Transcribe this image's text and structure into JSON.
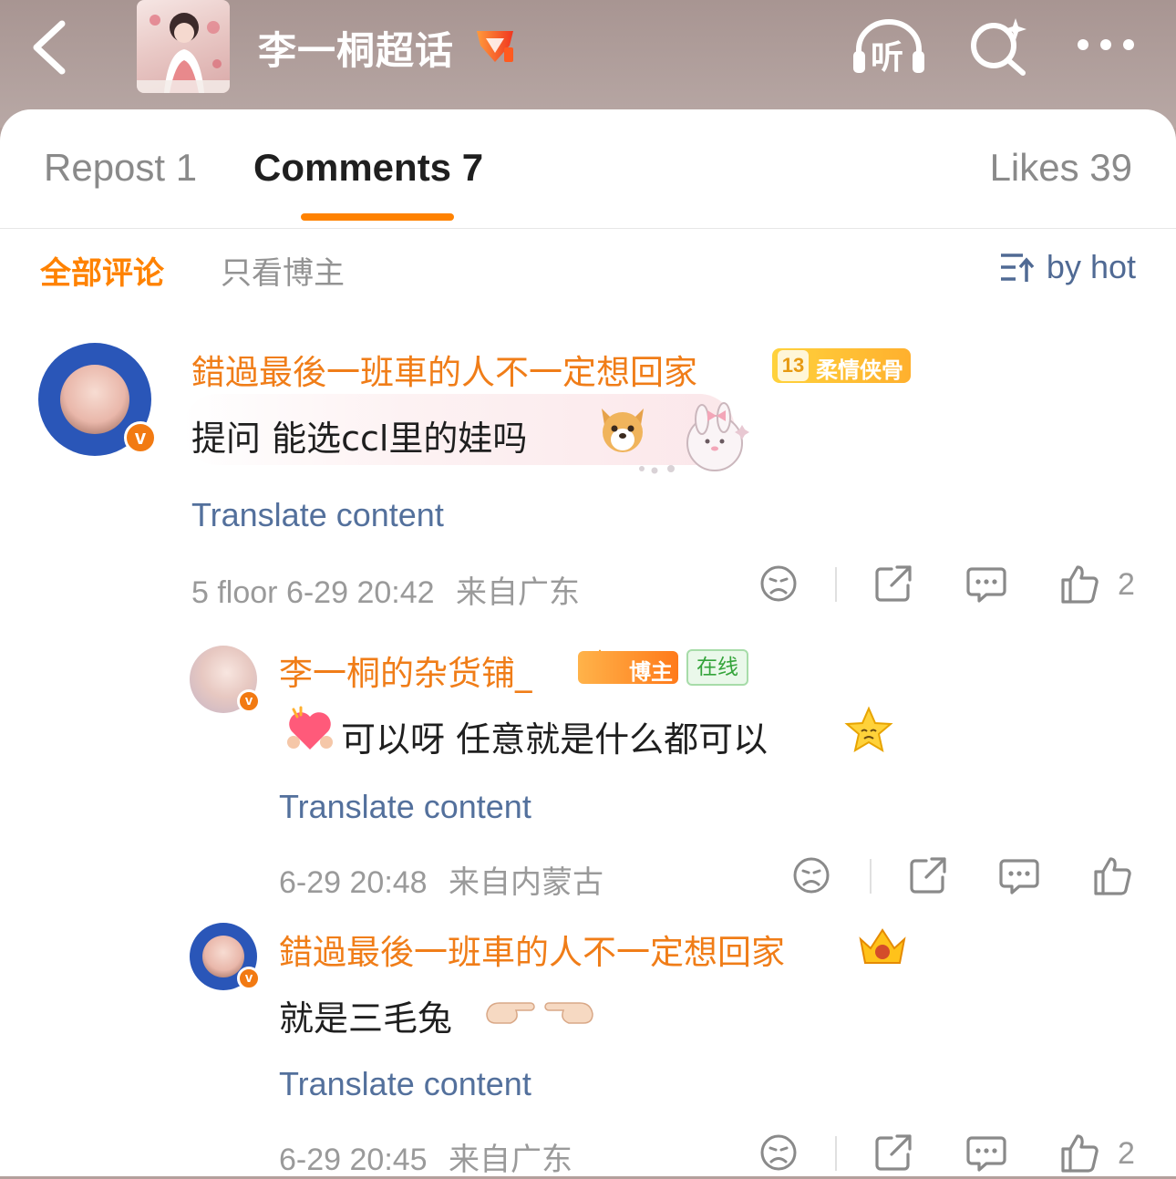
{
  "header": {
    "topic_title": "李一桐超话",
    "back_icon": "chevron-left-icon",
    "listen_label": "听",
    "search_icon": "search-sparkle-icon",
    "more_icon": "more-dots-icon"
  },
  "tabs": [
    {
      "label": "Repost 1"
    },
    {
      "label": "Comments 7"
    },
    {
      "label": "Likes 39"
    }
  ],
  "filters": {
    "all_label": "全部评论",
    "author_only_label": "只看博主",
    "sort_label": "by hot",
    "accent_color": "#ff8200"
  },
  "comments": [
    {
      "username": "錯過最後一班車的人不一定想回家",
      "level": "13",
      "level_title": "柔情侠骨",
      "text": "提问 能选ccl里的娃吗",
      "translate": "Translate content",
      "floor_time": "5 floor 6-29 20:42",
      "location": "来自广东",
      "likes": "2"
    },
    {
      "username": "李一桐的杂货铺_",
      "author_tag": "博主",
      "online_tag": "在线",
      "text": "可以呀 任意就是什么都可以",
      "translate": "Translate content",
      "time": "6-29 20:48",
      "location": "来自内蒙古",
      "likes": ""
    },
    {
      "username": "錯過最後一班車的人不一定想回家",
      "text": "就是三毛兔",
      "translate": "Translate content",
      "time": "6-29 20:45",
      "location": "来自广东",
      "likes": "2"
    }
  ]
}
